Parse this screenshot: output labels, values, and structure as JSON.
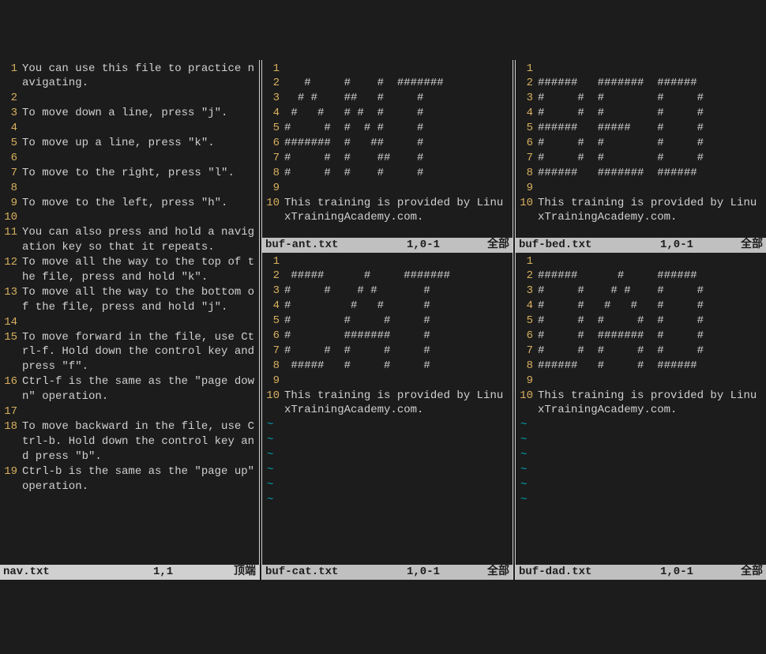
{
  "left": {
    "filename": "nav.txt",
    "position": "1,1",
    "percent": "顶端",
    "lines": [
      {
        "n": 1,
        "t": "You can use this file to practice navigating."
      },
      {
        "n": 2,
        "t": ""
      },
      {
        "n": 3,
        "t": "To move down a line, press \"j\"."
      },
      {
        "n": 4,
        "t": ""
      },
      {
        "n": 5,
        "t": "To move up a line, press \"k\"."
      },
      {
        "n": 6,
        "t": ""
      },
      {
        "n": 7,
        "t": "To move to the right, press \"l\"."
      },
      {
        "n": 8,
        "t": ""
      },
      {
        "n": 9,
        "t": "To move to the left, press \"h\"."
      },
      {
        "n": 10,
        "t": ""
      },
      {
        "n": 11,
        "t": "You can also press and hold a navigation key so that it repeats."
      },
      {
        "n": 12,
        "t": "To move all the way to the top of the file, press and hold \"k\"."
      },
      {
        "n": 13,
        "t": "To move all the way to the bottom of the file, press and hold \"j\"."
      },
      {
        "n": 14,
        "t": ""
      },
      {
        "n": 15,
        "t": "To move forward in the file, use Ctrl-f. Hold down the control key and press \"f\"."
      },
      {
        "n": 16,
        "t": "Ctrl-f is the same as the \"page down\" operation."
      },
      {
        "n": 17,
        "t": ""
      },
      {
        "n": 18,
        "t": "To move backward in the file, use Ctrl-b. Hold down the control key and press \"b\"."
      },
      {
        "n": 19,
        "t": "Ctrl-b is the same as the \"page up\" operation."
      }
    ]
  },
  "ant": {
    "filename": "buf-ant.txt",
    "position": "1,0-1",
    "percent": "全部",
    "lines": [
      {
        "n": 1,
        "t": ""
      },
      {
        "n": 2,
        "t": "   #     #    #  #######"
      },
      {
        "n": 3,
        "t": "  # #    ##   #     #"
      },
      {
        "n": 4,
        "t": " #   #   # #  #     #"
      },
      {
        "n": 5,
        "t": "#     #  #  # #     #"
      },
      {
        "n": 6,
        "t": "#######  #   ##     #"
      },
      {
        "n": 7,
        "t": "#     #  #    ##    #"
      },
      {
        "n": 8,
        "t": "#     #  #    #     #"
      },
      {
        "n": 9,
        "t": ""
      },
      {
        "n": 10,
        "t": "This training is provided by LinuxTrainingAcademy.com."
      }
    ]
  },
  "bed": {
    "filename": "buf-bed.txt",
    "position": "1,0-1",
    "percent": "全部",
    "lines": [
      {
        "n": 1,
        "t": ""
      },
      {
        "n": 2,
        "t": "######   #######  ######"
      },
      {
        "n": 3,
        "t": "#     #  #        #     #"
      },
      {
        "n": 4,
        "t": "#     #  #        #     #"
      },
      {
        "n": 5,
        "t": "######   #####    #     #"
      },
      {
        "n": 6,
        "t": "#     #  #        #     #"
      },
      {
        "n": 7,
        "t": "#     #  #        #     #"
      },
      {
        "n": 8,
        "t": "######   #######  ######"
      },
      {
        "n": 9,
        "t": ""
      },
      {
        "n": 10,
        "t": "This training is provided by LinuxTrainingAcademy.com."
      }
    ]
  },
  "cat": {
    "filename": "buf-cat.txt",
    "position": "1,0-1",
    "percent": "全部",
    "lines": [
      {
        "n": 1,
        "t": ""
      },
      {
        "n": 2,
        "t": " #####      #     #######"
      },
      {
        "n": 3,
        "t": "#     #    # #       #"
      },
      {
        "n": 4,
        "t": "#         #   #      #"
      },
      {
        "n": 5,
        "t": "#        #     #     #"
      },
      {
        "n": 6,
        "t": "#        #######     #"
      },
      {
        "n": 7,
        "t": "#     #  #     #     #"
      },
      {
        "n": 8,
        "t": " #####   #     #     #"
      },
      {
        "n": 9,
        "t": ""
      },
      {
        "n": 10,
        "t": "This training is provided by LinuxTrainingAcademy.com."
      }
    ],
    "tildes": 6
  },
  "dad": {
    "filename": "buf-dad.txt",
    "position": "1,0-1",
    "percent": "全部",
    "lines": [
      {
        "n": 1,
        "t": ""
      },
      {
        "n": 2,
        "t": "######      #     ######"
      },
      {
        "n": 3,
        "t": "#     #    # #    #     #"
      },
      {
        "n": 4,
        "t": "#     #   #   #   #     #"
      },
      {
        "n": 5,
        "t": "#     #  #     #  #     #"
      },
      {
        "n": 6,
        "t": "#     #  #######  #     #"
      },
      {
        "n": 7,
        "t": "#     #  #     #  #     #"
      },
      {
        "n": 8,
        "t": "######   #     #  ######"
      },
      {
        "n": 9,
        "t": ""
      },
      {
        "n": 10,
        "t": "This training is provided by LinuxTrainingAcademy.com."
      }
    ],
    "tildes": 6
  }
}
